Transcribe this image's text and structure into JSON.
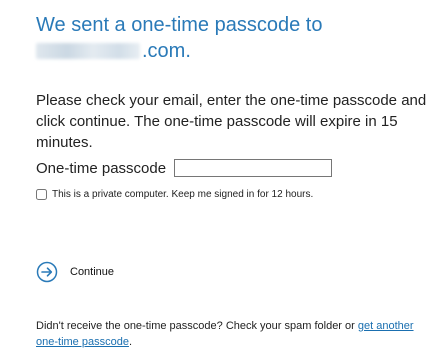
{
  "header": {
    "title_line1": "We sent a one-time passcode to",
    "email_suffix": ".com."
  },
  "instructions": {
    "text": "Please check your email, enter the one-time passcode and click continue. The one-time passcode will expire in 15 minutes."
  },
  "form": {
    "passcode_label": "One-time passcode",
    "passcode_value": "",
    "remember_label": "This is a private computer. Keep me signed in for 12 hours.",
    "remember_checked": false
  },
  "actions": {
    "continue_label": "Continue",
    "continue_icon": "arrow-right-circle-icon"
  },
  "footer": {
    "text": "Didn't receive the one-time passcode? Check your spam folder or ",
    "link_text": "get another one-time passcode",
    "end": "."
  },
  "colors": {
    "heading": "#2a7ab8",
    "link": "#1a6fb0",
    "icon": "#2a7ab8"
  }
}
